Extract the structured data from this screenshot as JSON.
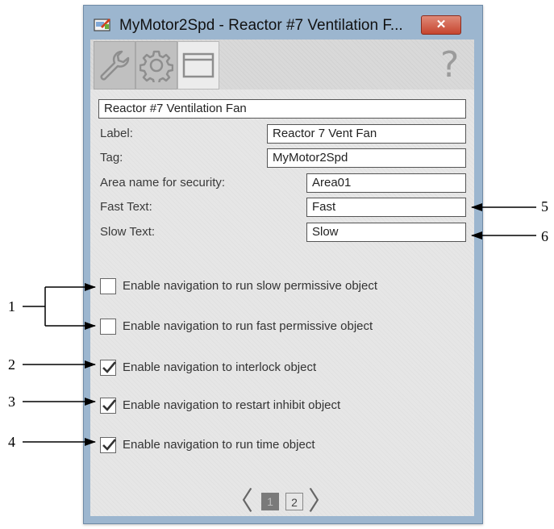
{
  "window": {
    "title": "MyMotor2Spd - Reactor #7 Ventilation F...",
    "close_label": "✕"
  },
  "toolbar": {
    "tabs": [
      {
        "name": "maintenance",
        "icon": "wrench-icon"
      },
      {
        "name": "engineering",
        "icon": "gear-icon"
      },
      {
        "name": "display",
        "icon": "window-icon"
      }
    ],
    "help_label": "?"
  },
  "form": {
    "description": "Reactor #7 Ventilation Fan",
    "label_caption": "Label:",
    "label_value": "Reactor 7 Vent Fan",
    "tag_caption": "Tag:",
    "tag_value": "MyMotor2Spd",
    "area_caption": "Area name for security:",
    "area_value": "Area01",
    "fast_caption": "Fast Text:",
    "fast_value": "Fast",
    "slow_caption": "Slow Text:",
    "slow_value": "Slow"
  },
  "checkboxes": [
    {
      "label": "Enable navigation to run slow permissive object",
      "checked": false
    },
    {
      "label": "Enable navigation to run fast permissive object",
      "checked": false
    },
    {
      "label": "Enable navigation to interlock object",
      "checked": true
    },
    {
      "label": "Enable navigation to restart inhibit object",
      "checked": true
    },
    {
      "label": "Enable navigation to run time object",
      "checked": true
    }
  ],
  "pager": {
    "prev": "〈",
    "pages": [
      "1",
      "2"
    ],
    "current": "1",
    "next": "〉"
  },
  "callouts": [
    "1",
    "2",
    "3",
    "4",
    "5",
    "6"
  ]
}
